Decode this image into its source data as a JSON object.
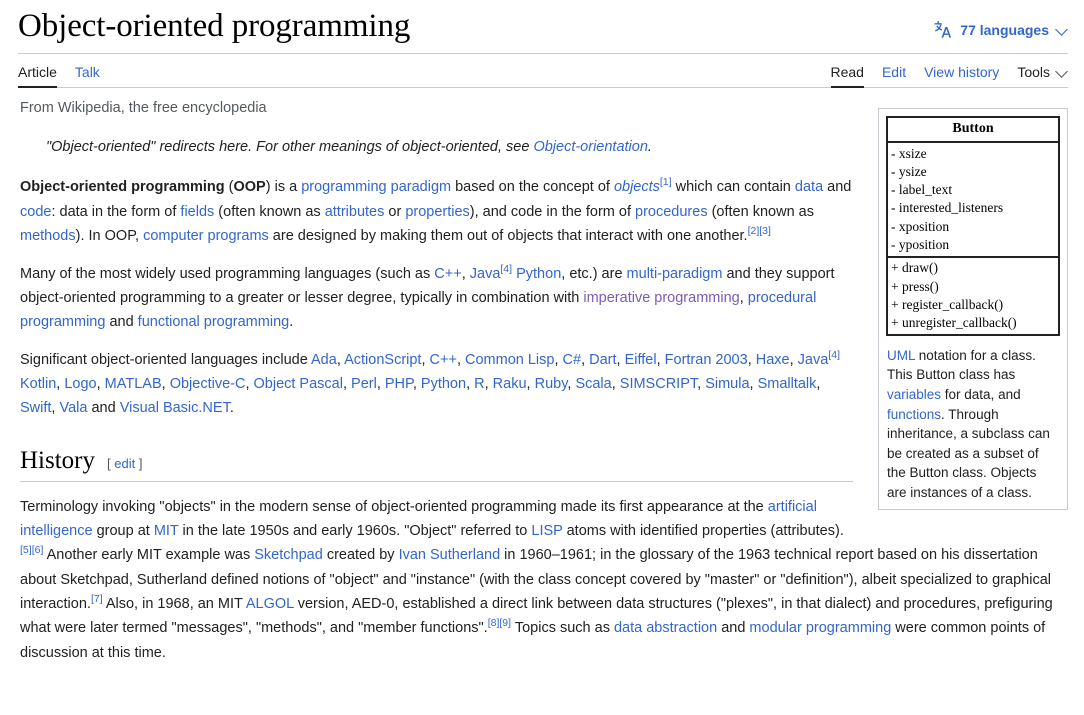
{
  "header": {
    "title": "Object-oriented programming",
    "language_button": {
      "icon": "language-icon",
      "label": "77 languages",
      "chevron": "chevron-down-icon"
    }
  },
  "namespace_tabs": [
    {
      "label": "Article",
      "selected": true
    },
    {
      "label": "Talk",
      "selected": false
    }
  ],
  "view_tabs": [
    {
      "label": "Read",
      "selected": true
    },
    {
      "label": "Edit",
      "selected": false
    },
    {
      "label": "View history",
      "selected": false
    }
  ],
  "tools_menu": {
    "label": "Tools",
    "chevron": "chevron-down-icon"
  },
  "site_sub": "From Wikipedia, the free encyclopedia",
  "hatnote": {
    "pre": "\"Object-oriented\" redirects here. For other meanings of object-oriented, see ",
    "link": "Object-orientation",
    "post": "."
  },
  "lead": {
    "p1": {
      "bold_term": "Object-oriented programming",
      "abbr": "OOP",
      "t1": " (",
      "t2": ") is a ",
      "l_paradigm": "programming paradigm",
      "t3": " based on the concept of ",
      "l_objects": "objects",
      "ref1": "[1]",
      "t4": " which can contain ",
      "l_data": "data",
      "t5": " and ",
      "l_code": "code",
      "t6": ": data in the form of ",
      "l_fields": "fields",
      "t7": " (often known as ",
      "l_attributes": "attributes",
      "t8": " or ",
      "l_properties": "properties",
      "t9": "), and code in the form of ",
      "l_procedures": "procedures",
      "t10": " (often known as ",
      "l_methods": "methods",
      "t11": "). In OOP, ",
      "l_computer_programs": "computer programs",
      "t12": " are designed by making them out of objects that interact with one another.",
      "ref2": "[2]",
      "ref3": "[3]"
    },
    "p2": {
      "t1": "Many of the most widely used programming languages (such as ",
      "l_cpp": "C++",
      "t2": ", ",
      "l_java": "Java",
      "ref4": "[4]",
      "t3": " ",
      "l_python": "Python",
      "t4": ", etc.) are ",
      "l_multiparadigm": "multi-paradigm",
      "t5": " and they support object-oriented programming to a greater or lesser degree, typically in combination with ",
      "l_imperative": "imperative programming",
      "t6": ", ",
      "l_procedural": "procedural programming",
      "t7": " and ",
      "l_functional": "functional programming",
      "t8": "."
    },
    "p3": {
      "t1": "Significant object-oriented languages include ",
      "languages": [
        "Ada",
        "ActionScript",
        "C++",
        "Common Lisp",
        "C#",
        "Dart",
        "Eiffel",
        "Fortran 2003",
        "Haxe",
        "Java",
        "Kotlin",
        "Logo",
        "MATLAB",
        "Objective-C",
        "Object Pascal",
        "Perl",
        "PHP",
        "Python",
        "R",
        "Raku",
        "Ruby",
        "Scala",
        "SIMSCRIPT",
        "Simula",
        "Smalltalk",
        "Swift",
        "Vala"
      ],
      "java_ref": "[4]",
      "t_and": " and ",
      "l_vbnet": "Visual Basic.NET",
      "t_end": "."
    }
  },
  "history_section": {
    "heading": "History",
    "edit_bracket_open": "[",
    "edit_label": "edit",
    "edit_bracket_close": "]",
    "p1": {
      "t1": "Terminology invoking \"objects\" in the modern sense of object-oriented programming made its first appearance at the ",
      "l_ai": "artificial intelligence",
      "t2": " group at ",
      "l_mit": "MIT",
      "t3": " in the late 1950s and early 1960s. \"Object\" referred to ",
      "l_lisp": "LISP",
      "t4": " atoms with identified properties (attributes).",
      "ref5": "[5]",
      "ref6": "[6]",
      "t5": " Another early MIT example was ",
      "l_sketchpad": "Sketchpad",
      "t6": " created by ",
      "l_ivan": "Ivan Sutherland",
      "t7": " in 1960–1961; in the glossary of the 1963 technical report based on his dissertation about Sketchpad, Sutherland defined notions of \"object\" and \"instance\" (with the class concept covered by \"master\" or \"definition\"), albeit specialized to graphical interaction.",
      "ref7": "[7]",
      "t8": " Also, in 1968, an MIT ",
      "l_algol": "ALGOL",
      "t9": " version, AED-0, established a direct link between data structures (\"plexes\", in that dialect) and procedures, prefiguring what were later termed \"messages\", \"methods\", and \"member functions\".",
      "ref8": "[8]",
      "ref9": "[9]",
      "t10": " Topics such as ",
      "l_data_abstraction": "data abstraction",
      "t11": " and ",
      "l_modular": "modular programming",
      "t12": " were common points of discussion at this time."
    }
  },
  "infobox": {
    "uml": {
      "class_name": "Button",
      "attributes": [
        "- xsize",
        "- ysize",
        "- label_text",
        "- interested_listeners",
        "- xposition",
        "- yposition"
      ],
      "operations": [
        "+ draw()",
        "+ press()",
        "+ register_callback()",
        "+ unregister_callback()"
      ]
    },
    "caption": {
      "l_uml": "UML",
      "t1": " notation for a class. This Button class has ",
      "l_variables": "variables",
      "t2": " for data, and ",
      "l_functions": "functions",
      "t3": ". Through inheritance, a subclass can be created as a subset of the Button class. Objects are instances of a class."
    }
  },
  "colors": {
    "link": "#3366cc",
    "link_visited": "#795cb2",
    "text": "#202122",
    "border": "#c8ccd1",
    "uml_border": "#222222"
  }
}
